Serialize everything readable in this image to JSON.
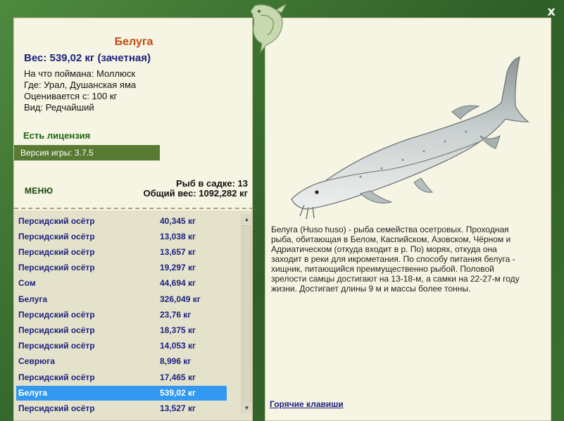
{
  "window": {
    "close_label": "x"
  },
  "fish": {
    "name": "Белуга",
    "weight": "Вес: 539,02 кг (зачетная)",
    "info": [
      "На что поймана: Моллюск",
      "Где: Урал, Душанская яма",
      "Оценивается с: 100 кг",
      "Вид: Редчайший"
    ],
    "license": "Есть лицензия",
    "description": "Белуга (Huso huso) - рыба семейства осетровых. Проходная рыба, обитающая в Белом, Каспийском, Азовском, Чёрном и Адриатическом (откуда входит в р. По) морях, откуда она заходит в реки для икрометания. По способу питания белуга - хищник, питающийся преимущественно рыбой. Половой зрелости самцы достигают на 13-18-м, а самки на 22-27-м году жизни. Достигает длины 9 м и массы более тонны."
  },
  "version": "Версия игры: 3.7.5",
  "menu_label": "МЕНЮ",
  "keepnet": {
    "count": "Рыб в садке: 13",
    "total": "Общий вес: 1092,282 кг"
  },
  "catch_list": [
    {
      "name": "Персидский осётр",
      "weight": "40,345 кг",
      "selected": false
    },
    {
      "name": "Персидский осётр",
      "weight": "13,038 кг",
      "selected": false
    },
    {
      "name": "Персидский осётр",
      "weight": "13,657 кг",
      "selected": false
    },
    {
      "name": "Персидский осётр",
      "weight": "19,297 кг",
      "selected": false
    },
    {
      "name": "Сом",
      "weight": "44,694 кг",
      "selected": false
    },
    {
      "name": "Белуга",
      "weight": "326,049 кг",
      "selected": false
    },
    {
      "name": "Персидский осётр",
      "weight": "23,76 кг",
      "selected": false
    },
    {
      "name": "Персидский осётр",
      "weight": "18,375 кг",
      "selected": false
    },
    {
      "name": "Персидский осётр",
      "weight": "14,053 кг",
      "selected": false
    },
    {
      "name": "Севрюга",
      "weight": "8,996 кг",
      "selected": false
    },
    {
      "name": "Персидский осётр",
      "weight": "17,465 кг",
      "selected": false
    },
    {
      "name": "Белуга",
      "weight": "539,02 кг",
      "selected": true
    },
    {
      "name": "Персидский осётр",
      "weight": "13,527 кг",
      "selected": false
    }
  ],
  "scroll": {
    "up_icon": "scroll-up-arrow",
    "down_icon": "scroll-down-arrow"
  },
  "hotkeys_label": "Горячие клавиши",
  "colors": {
    "frame": "#3d6e32",
    "panel": "#f6f4e2",
    "fish_name": "#c24a12",
    "list_text": "#1b237e",
    "selection": "#3398ef",
    "version_bar": "#587a33"
  }
}
